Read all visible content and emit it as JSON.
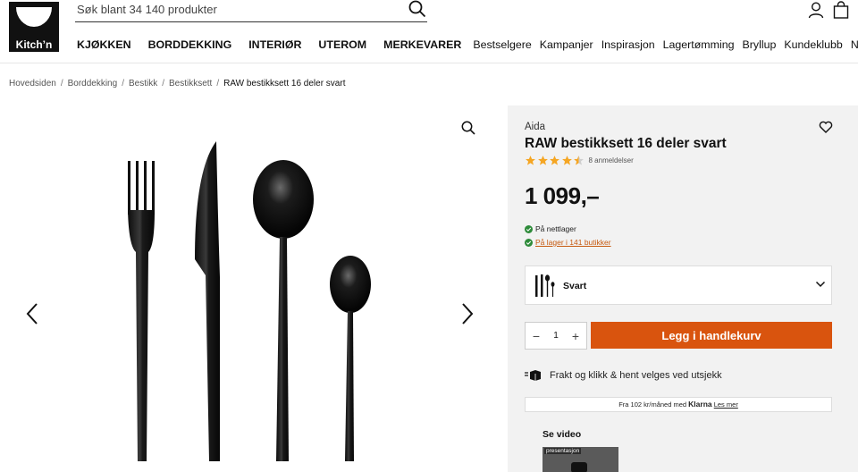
{
  "header": {
    "logo_text": "Kitch’n",
    "search_placeholder": "Søk blant 34 140 produkter",
    "icons": [
      "search-icon",
      "account-icon",
      "cart-icon"
    ]
  },
  "nav": {
    "primary": [
      "KJØKKEN",
      "BORDDEKKING",
      "INTERIØR",
      "UTEROM",
      "MERKEVARER"
    ],
    "secondary": [
      "Bestselgere",
      "Kampanjer",
      "Inspirasjon",
      "Lagertømming",
      "Bryllup",
      "Kundeklubb",
      "Nyheter"
    ]
  },
  "breadcrumb": {
    "items": [
      "Hovedsiden",
      "Borddekking",
      "Bestikk",
      "Bestikksett"
    ],
    "current": "RAW bestikksett 16 deler svart",
    "separator": "/"
  },
  "gallery": {
    "icons": [
      "zoom-icon",
      "prev-arrow-icon",
      "next-arrow-icon"
    ]
  },
  "product": {
    "brand": "Aida",
    "title": "RAW bestikksett 16 deler svart",
    "rating": 4.5,
    "rating_max": 5,
    "reviews": "8 anmeldelser",
    "price": "1 099,–",
    "stock_online": "På nettlager",
    "stock_stores": "På lager i 141 butikker",
    "variant": "Svart",
    "quantity": "1",
    "qty_minus": "−",
    "qty_plus": "+",
    "add_to_cart": "Legg i handlekurv",
    "delivery": "Frakt og klikk & hent velges ved utsjekk",
    "klarna_prefix": "Fra 102 kr/måned med",
    "klarna_logo": "Klarna",
    "klarna_link": "Les mer",
    "video_label": "Se video",
    "video_tag": "presentasjon"
  },
  "colors": {
    "accent": "#d9540e",
    "star": "#f5a623",
    "stock_green": "#2e8b3a",
    "panel_bg": "#f2f2f2"
  }
}
